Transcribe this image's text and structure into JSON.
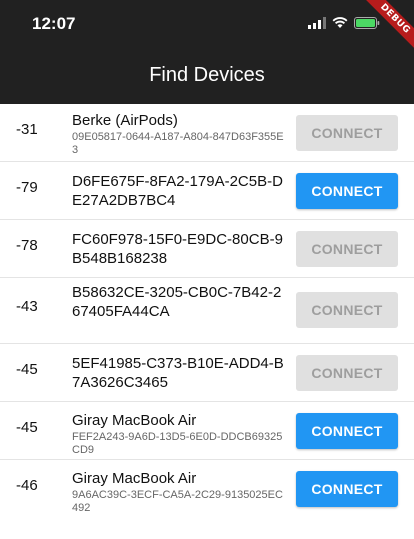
{
  "status_bar": {
    "time": "12:07",
    "icons": [
      "signal-icon",
      "wifi-icon",
      "battery-icon"
    ]
  },
  "debug_banner": "DEBUG",
  "app_bar": {
    "title": "Find Devices"
  },
  "colors": {
    "app_bar": "#212121",
    "button_enabled": "#2196f3",
    "button_disabled": "#e0e0e0"
  },
  "devices": [
    {
      "rssi": "-31",
      "name": "Berke (AirPods)",
      "id": "09E05817-0644-A187-A804-847D63F355E3",
      "button": "CONNECT",
      "connectable": false
    },
    {
      "rssi": "-79",
      "name": "D6FE675F-8FA2-179A-2C5B-DE27A2DB7BC4",
      "id": "",
      "button": "CONNECT",
      "connectable": true
    },
    {
      "rssi": "-78",
      "name": "FC60F978-15F0-E9DC-80CB-9B548B168238",
      "id": "",
      "button": "CONNECT",
      "connectable": false
    },
    {
      "rssi": "-43",
      "name": "B58632CE-3205-CB0C-7B42-267405FA44CA",
      "id": "",
      "button": "CONNECT",
      "connectable": false
    },
    {
      "rssi": "-45",
      "name": "5EF41985-C373-B10E-ADD4-B7A3626C3465",
      "id": "",
      "button": "CONNECT",
      "connectable": false
    },
    {
      "rssi": "-45",
      "name": "Giray MacBook Air",
      "id": "FEF2A243-9A6D-13D5-6E0D-DDCB69325CD9",
      "button": "CONNECT",
      "connectable": true
    },
    {
      "rssi": "-46",
      "name": "Giray MacBook Air",
      "id": "9A6AC39C-3ECF-CA5A-2C29-9135025EC492",
      "button": "CONNECT",
      "connectable": true
    }
  ]
}
